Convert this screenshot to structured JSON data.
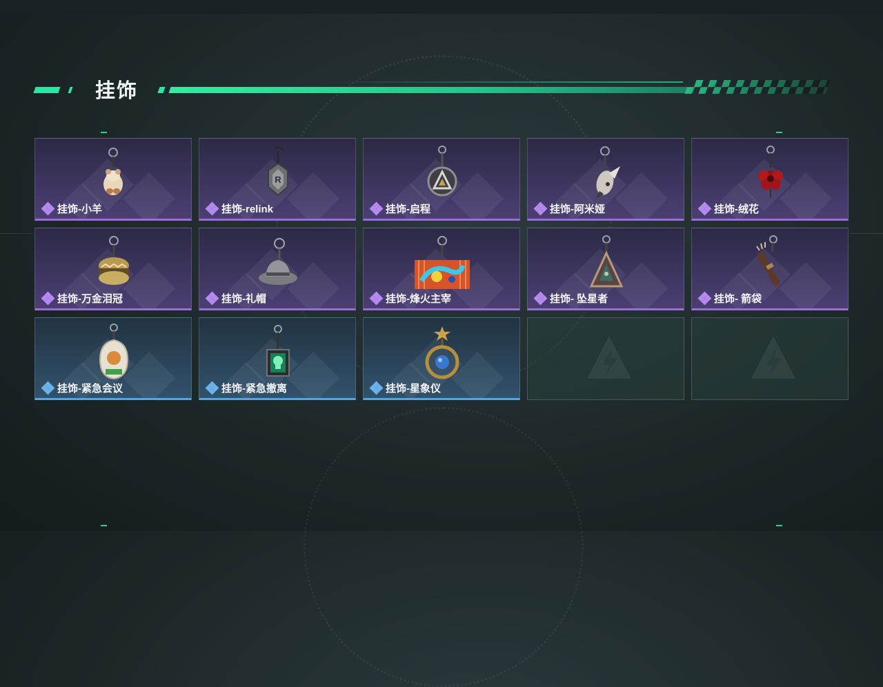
{
  "section": {
    "title": "挂饰"
  },
  "colors": {
    "accent": "#2fe3a0",
    "epic": "#9a6fdc",
    "rare": "#5aa5dd"
  },
  "items": [
    {
      "label": "挂饰-小羊",
      "rarity": "epic",
      "icon": "lamb-charm-icon"
    },
    {
      "label": "挂饰-relink",
      "rarity": "epic",
      "icon": "relink-charm-icon"
    },
    {
      "label": "挂饰-启程",
      "rarity": "epic",
      "icon": "triangle-emblem-charm-icon"
    },
    {
      "label": "挂饰-阿米娅",
      "rarity": "epic",
      "icon": "bunny-plush-charm-icon"
    },
    {
      "label": "挂饰-绒花",
      "rarity": "epic",
      "icon": "red-flower-charm-icon"
    },
    {
      "label": "挂饰-万金泪冠",
      "rarity": "epic",
      "icon": "golden-crown-charm-icon"
    },
    {
      "label": "挂饰-礼帽",
      "rarity": "epic",
      "icon": "fedora-hat-charm-icon"
    },
    {
      "label": "挂饰-烽火主宰",
      "rarity": "epic",
      "icon": "graffiti-container-charm-icon"
    },
    {
      "label": "挂饰- 坠星者",
      "rarity": "epic",
      "icon": "star-triangle-charm-icon"
    },
    {
      "label": "挂饰- 箭袋",
      "rarity": "epic",
      "icon": "quiver-charm-icon"
    },
    {
      "label": "挂饰-紧急会议",
      "rarity": "rare",
      "icon": "meeting-badge-charm-icon"
    },
    {
      "label": "挂饰-紧急撤离",
      "rarity": "rare",
      "icon": "skull-frame-charm-icon"
    },
    {
      "label": "挂饰-星象仪",
      "rarity": "rare",
      "icon": "astrolabe-charm-icon"
    }
  ],
  "empty_slots": 2
}
